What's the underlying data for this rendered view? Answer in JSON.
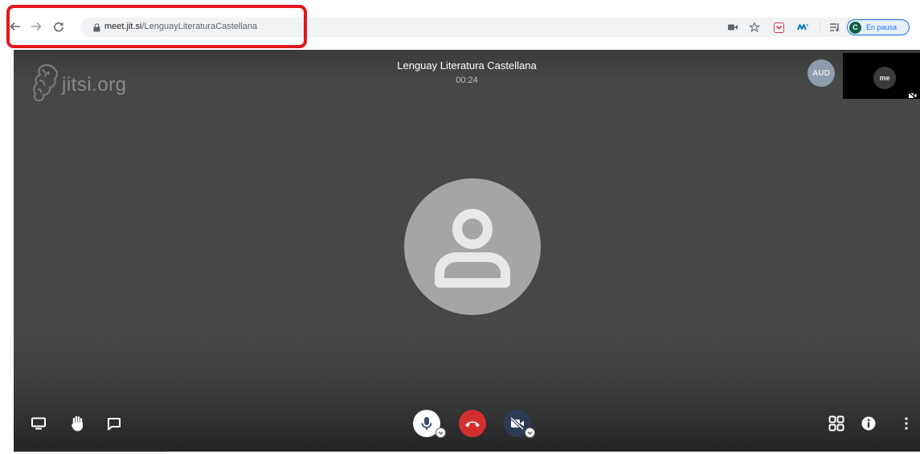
{
  "browser": {
    "url_host": "meet.jit.si",
    "url_path": "/LenguayLiteraturaCastellana",
    "profile_initial": "C",
    "profile_label": "En pausa",
    "icons": [
      "back-icon",
      "forward-icon",
      "reload-icon",
      "lock-icon",
      "camera-blocked-icon",
      "star-icon",
      "pocket-extension-icon",
      "movistar-extension-icon",
      "media-queue-icon"
    ]
  },
  "meeting": {
    "brand": "jitsi.org",
    "title": "Lenguay Literatura Castellana",
    "timer": "00:24",
    "remote_participant_initials": "AUD",
    "local_label": "me"
  },
  "toolbar": {
    "left": [
      "screen-share-icon",
      "raise-hand-icon",
      "chat-icon"
    ],
    "center": [
      "microphone-icon",
      "hangup-icon",
      "camera-off-icon"
    ],
    "right": [
      "tile-view-icon",
      "info-icon",
      "more-options-icon"
    ]
  },
  "colors": {
    "hangup": "#d32f2f",
    "highlight": "#e2171b",
    "camera_button": "#2d3a55",
    "aud_avatar": "#8e9cae"
  }
}
